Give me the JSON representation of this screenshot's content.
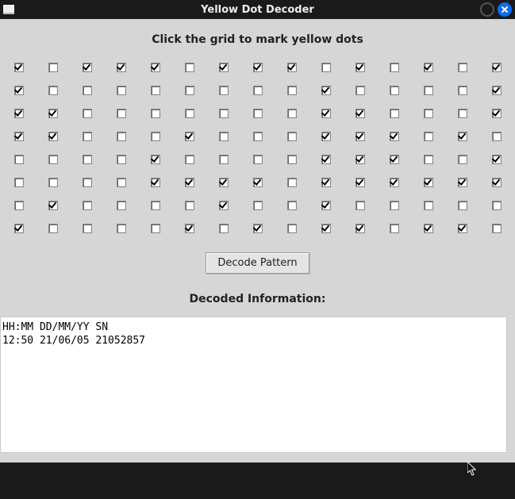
{
  "window": {
    "title": "Yellow Dot Decoder"
  },
  "instruction": "Click the grid to mark yellow dots",
  "grid": {
    "rows": 8,
    "cols": 15,
    "checked": [
      [
        1,
        0,
        1,
        1,
        1,
        0,
        1,
        1,
        1,
        0,
        1,
        0,
        1,
        0,
        1
      ],
      [
        1,
        0,
        0,
        0,
        0,
        0,
        0,
        0,
        0,
        1,
        0,
        0,
        0,
        0,
        1
      ],
      [
        1,
        1,
        0,
        0,
        0,
        0,
        0,
        0,
        0,
        1,
        1,
        0,
        0,
        0,
        1
      ],
      [
        1,
        1,
        0,
        0,
        0,
        1,
        0,
        0,
        0,
        1,
        1,
        1,
        0,
        1,
        0
      ],
      [
        0,
        0,
        0,
        0,
        1,
        0,
        0,
        0,
        0,
        1,
        1,
        1,
        0,
        0,
        1
      ],
      [
        0,
        0,
        0,
        0,
        1,
        1,
        1,
        1,
        0,
        1,
        1,
        1,
        1,
        1,
        1
      ],
      [
        0,
        1,
        0,
        0,
        0,
        0,
        1,
        0,
        0,
        1,
        0,
        0,
        0,
        0,
        0
      ],
      [
        1,
        0,
        0,
        0,
        0,
        1,
        0,
        1,
        0,
        1,
        1,
        0,
        1,
        1,
        0
      ]
    ]
  },
  "decode_button_label": "Decode Pattern",
  "decoded_label": "Decoded Information:",
  "output_text": "HH:MM DD/MM/YY SN\n12:50 21/06/05 21052857"
}
